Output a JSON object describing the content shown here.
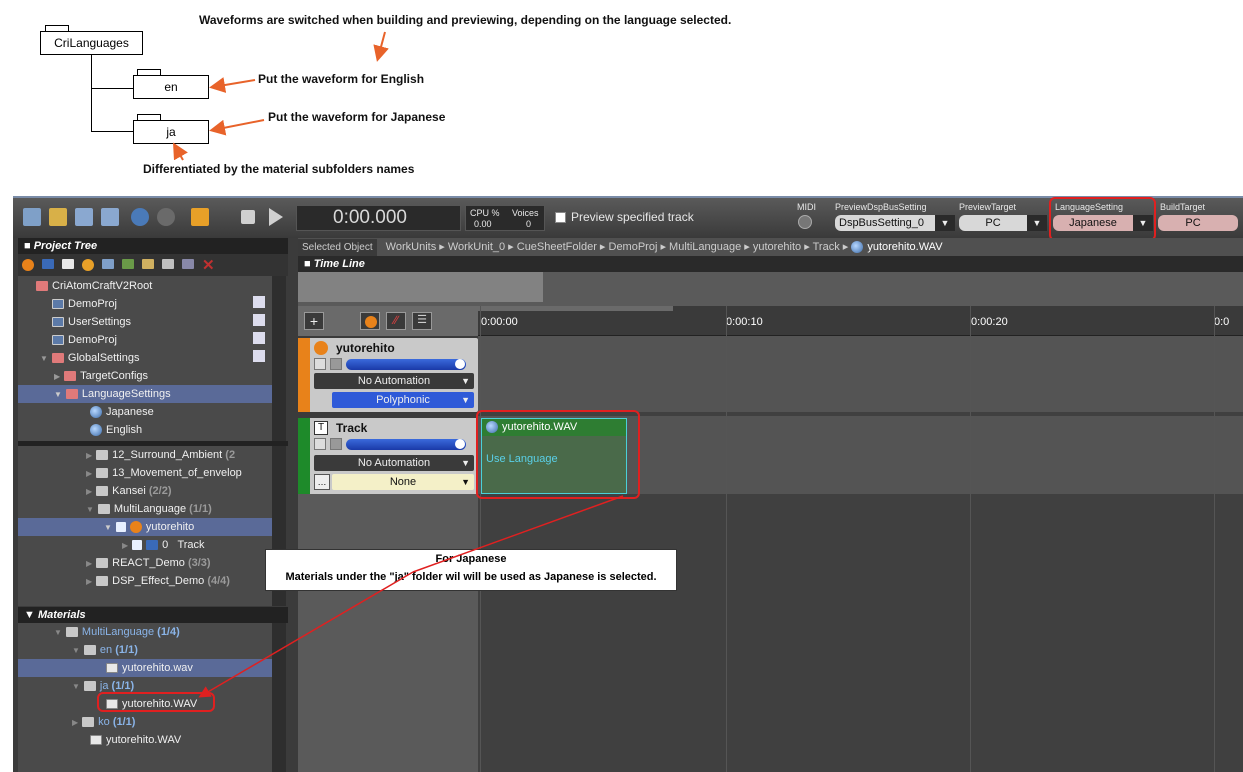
{
  "diagram": {
    "root_folder": "CriLanguages",
    "sub_folder_en": "en",
    "sub_folder_ja": "ja",
    "note_top": "Waveforms are switched when building and previewing, depending on the language selected.",
    "note_en": "Put the waveform for English",
    "note_ja": "Put the waveform for Japanese",
    "note_bottom": "Differentiated by the material subfolders names"
  },
  "toolbar": {
    "time": "0:00.000",
    "cpu_label": "CPU %",
    "cpu_value": "0.00",
    "voices_label": "Voices",
    "voices_value": "0",
    "preview_label": "Preview specified track",
    "midi_label": "MIDI",
    "dsp_label": "PreviewDspBusSetting",
    "dsp_value": "DspBusSetting_0",
    "preview_target_label": "PreviewTarget",
    "preview_target_value": "PC",
    "language_label": "LanguageSetting",
    "language_value": "Japanese",
    "build_target_label": "BuildTarget",
    "build_target_value": "PC"
  },
  "project_tree": {
    "title": "Project Tree",
    "items": [
      {
        "label": "CriAtomCraftV2Root"
      },
      {
        "label": "DemoProj"
      },
      {
        "label": "UserSettings"
      },
      {
        "label": "DemoProj"
      },
      {
        "label": "GlobalSettings"
      },
      {
        "label": "TargetConfigs"
      },
      {
        "label": "LanguageSettings"
      },
      {
        "label": "Japanese"
      },
      {
        "label": "English"
      }
    ],
    "lower_items": [
      {
        "label": "12_Surround_Ambient",
        "count": "(2"
      },
      {
        "label": "13_Movement_of_envelop",
        "count": ""
      },
      {
        "label": "Kansei",
        "count": "(2/2)"
      },
      {
        "label": "MultiLanguage",
        "count": "(1/1)"
      },
      {
        "label": "yutorehito",
        "count": ""
      },
      {
        "label": "0",
        "count": "Track"
      },
      {
        "label": "REACT_Demo",
        "count": "(3/3)"
      },
      {
        "label": "DSP_Effect_Demo",
        "count": "(4/4)"
      }
    ]
  },
  "materials": {
    "title": "Materials",
    "items": [
      {
        "label": "MultiLanguage",
        "count": "(1/4)"
      },
      {
        "label": "en",
        "count": "(1/1)"
      },
      {
        "label": "yutorehito.wav",
        "count": ""
      },
      {
        "label": "ja",
        "count": "(1/1)"
      },
      {
        "label": "yutorehito.WAV",
        "count": ""
      },
      {
        "label": "ko",
        "count": "(1/1)"
      },
      {
        "label": "yutorehito.WAV",
        "count": ""
      }
    ]
  },
  "breadcrumb": {
    "label": "Selected Object",
    "items": [
      "WorkUnits",
      "WorkUnit_0",
      "CueSheetFolder",
      "DemoProj",
      "MultiLanguage",
      "yutorehito",
      "Track",
      "yutorehito.WAV"
    ]
  },
  "timeline": {
    "title": "Time Line",
    "ticks": [
      "0:00:00",
      "0:00:10",
      "0:00:20",
      "0:0"
    ],
    "cue": {
      "name": "yutorehito",
      "automation": "No Automation",
      "mode": "Polyphonic"
    },
    "track": {
      "name": "Track",
      "automation": "No Automation",
      "mode": "None"
    },
    "clip": {
      "name": "yutorehito.WAV",
      "sub": "Use Language"
    }
  },
  "callout": {
    "line1": "For Japanese",
    "line2": "Materials under the \"ja\" folder wil will be used as Japanese is selected."
  },
  "colors": {
    "accent_red": "#e02020",
    "arrow_orange": "#e8632a",
    "clip_green": "#2e7d32"
  }
}
